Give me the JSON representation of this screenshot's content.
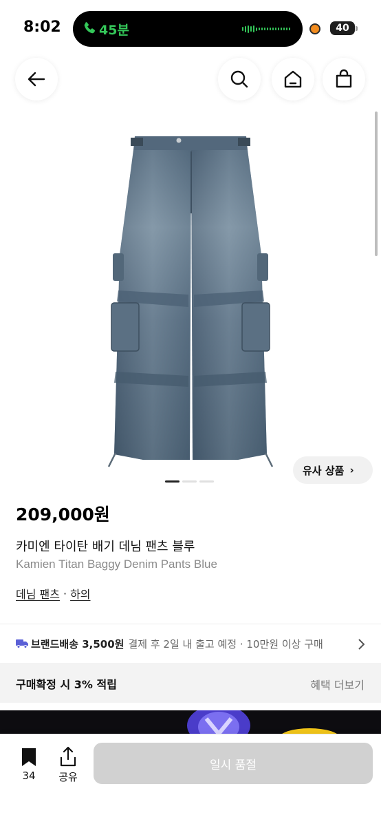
{
  "status_bar": {
    "time": "8:02",
    "call_duration": "45분",
    "battery": "40",
    "call_color": "#34c759",
    "record_dot_color": "#f28c1f"
  },
  "header": {
    "back_icon": "arrow-left-icon",
    "search_icon": "search-icon",
    "home_icon": "home-icon",
    "cart_icon": "shopping-bag-icon"
  },
  "gallery": {
    "image_alt_icon": "denim-pants-image",
    "page_count": 3,
    "active_page": 1,
    "similar_label": "유사 상품",
    "similar_chevron": "›"
  },
  "product": {
    "price": "209,000원",
    "title_ko": "카미엔 타이탄 배기 데님 팬츠 블루",
    "title_en": "Kamien Titan Baggy Denim Pants Blue",
    "category": "데님 팬츠",
    "separator": "·",
    "parent_category": "하의"
  },
  "shipping": {
    "icon": "truck-icon",
    "icon_color": "#5a5fd6",
    "label": "브랜드배송 3,500원",
    "detail": "결제 후 2일 내 출고 예정 · 10만원 이상 구매"
  },
  "points": {
    "label": "구매확정 시 3% 적립",
    "link": "혜택 더보기"
  },
  "bottom_bar": {
    "bookmark_count": "34",
    "share_label": "공유",
    "soldout_label": "일시 품절",
    "soldout_color": "#d1d1d1"
  }
}
